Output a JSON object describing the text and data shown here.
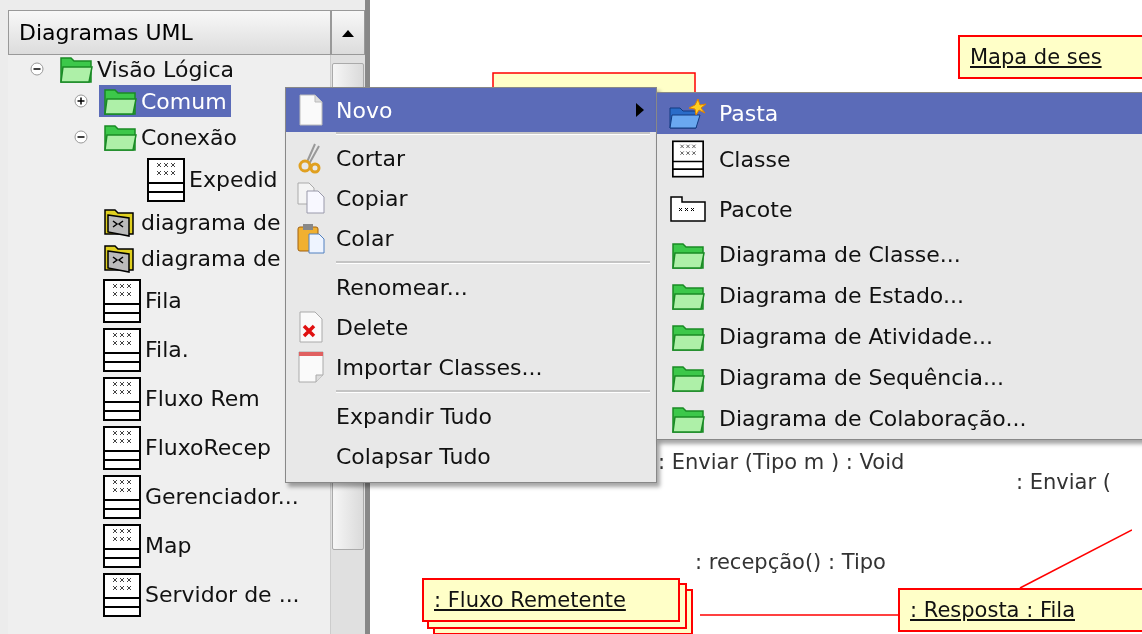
{
  "panel": {
    "title": "Diagramas UML"
  },
  "tree": [
    {
      "label": "Visão Lógica",
      "kind": "folder",
      "expanded": true,
      "selected": false,
      "children": [
        {
          "label": "Comum",
          "kind": "folder",
          "expanded": false,
          "selected": true
        },
        {
          "label": "Conexão",
          "kind": "folder",
          "expanded": true,
          "selected": false,
          "children": [
            {
              "label": "Expedid",
              "kind": "class",
              "selected": false
            }
          ]
        },
        {
          "label": "diagrama de",
          "kind": "diagram",
          "selected": false
        },
        {
          "label": "diagrama de",
          "kind": "diagram",
          "selected": false
        },
        {
          "label": "Fila",
          "kind": "class",
          "selected": false
        },
        {
          "label": "Fila.",
          "kind": "class",
          "selected": false
        },
        {
          "label": "Fluxo Rem",
          "kind": "class",
          "selected": false
        },
        {
          "label": "FluxoRecep",
          "kind": "class",
          "selected": false
        },
        {
          "label": "Gerenciador...",
          "kind": "class",
          "selected": false
        },
        {
          "label": "Map",
          "kind": "class",
          "selected": false
        },
        {
          "label": "Servidor de ...",
          "kind": "class",
          "selected": false
        }
      ]
    }
  ],
  "canvas": {
    "objects": [
      {
        "kind": "object",
        "label": "Mapa de ses",
        "stacked": false
      },
      {
        "kind": "object",
        "label": ": Fluxo Remetente",
        "stacked": true
      },
      {
        "kind": "object",
        "label": ": Resposta : Fila",
        "stacked": false
      },
      {
        "kind": "message",
        "label": ": Enviar (Tipo m ) : Void"
      },
      {
        "kind": "message",
        "label": ": Enviar ("
      },
      {
        "kind": "message",
        "label": ": recepção() : Tipo"
      }
    ]
  },
  "context_menu": {
    "items": [
      {
        "kind": "item",
        "label": "Novo",
        "selected": true,
        "submenu": true
      },
      {
        "kind": "separator"
      },
      {
        "kind": "item",
        "label": "Cortar",
        "selected": false,
        "submenu": false
      },
      {
        "kind": "item",
        "label": "Copiar",
        "selected": false,
        "submenu": false
      },
      {
        "kind": "item",
        "label": "Colar",
        "selected": false,
        "submenu": false
      },
      {
        "kind": "separator"
      },
      {
        "kind": "item",
        "label": "Renomear...",
        "selected": false,
        "submenu": false
      },
      {
        "kind": "item",
        "label": "Delete",
        "selected": false,
        "submenu": false
      },
      {
        "kind": "item",
        "label": "Importar Classes...",
        "selected": false,
        "submenu": false
      },
      {
        "kind": "separator"
      },
      {
        "kind": "item",
        "label": "Expandir Tudo",
        "selected": false,
        "submenu": false
      },
      {
        "kind": "item",
        "label": "Colapsar Tudo",
        "selected": false,
        "submenu": false
      }
    ]
  },
  "submenu": {
    "items": [
      {
        "label": "Pasta",
        "selected": true
      },
      {
        "label": "Classe",
        "selected": false
      },
      {
        "label": "Pacote",
        "selected": false
      },
      {
        "label": "Diagrama de Classe...",
        "selected": false
      },
      {
        "label": "Diagrama de Estado...",
        "selected": false
      },
      {
        "label": "Diagrama de Atividade...",
        "selected": false
      },
      {
        "label": "Diagrama de Sequência...",
        "selected": false
      },
      {
        "label": "Diagrama de Colaboração...",
        "selected": false
      }
    ]
  }
}
